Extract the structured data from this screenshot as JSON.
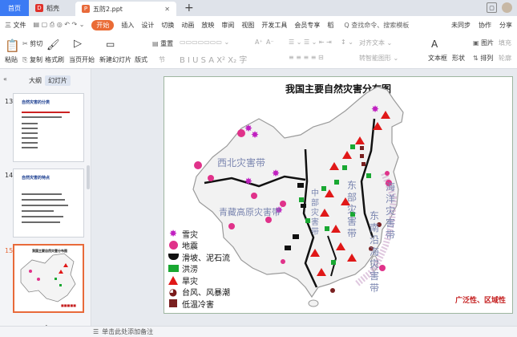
{
  "tabs": [
    {
      "label": "首页"
    },
    {
      "label": "稻壳"
    },
    {
      "label": "五防2.ppt"
    }
  ],
  "menu": {
    "file": "三 文件",
    "items": [
      "开始",
      "插入",
      "设计",
      "切换",
      "动画",
      "放映",
      "审阅",
      "视图",
      "开发工具",
      "会员专享",
      "稻"
    ],
    "search": "Q 查找命令、搜索模板",
    "right": [
      "未同步",
      "协作",
      "分享"
    ]
  },
  "toolbar": {
    "paste": "粘贴",
    "cut": "剪切",
    "copy": "复制",
    "format_painter": "格式刷",
    "from_current": "当页开始",
    "new_slide": "新建幻灯片",
    "layout": "版式",
    "section": "节",
    "reset": "重置",
    "font_size_up": "A⁺",
    "font_size_down": "A⁻",
    "align_text": "对齐文本",
    "convert_smartart": "转智能图形",
    "text_box": "文本框",
    "shape": "形状",
    "arrange": "排列",
    "picture": "图片",
    "fill": "填充",
    "outline": "轮廓"
  },
  "panel": {
    "collapse": "«",
    "tab_outline": "大纲",
    "tab_slides": "幻灯片",
    "slides": [
      {
        "num": "13",
        "title": "自然灾害的分类"
      },
      {
        "num": "14",
        "title": "自然灾害的特点"
      },
      {
        "num": "15",
        "title": "我国主要自然灾害分布图"
      }
    ],
    "add": "+"
  },
  "slide": {
    "title": "我国主要自然灾害分布图",
    "regions": {
      "northwest": "西北灾害带",
      "qingzang": "青藏高原灾害带",
      "central": [
        "中",
        "部",
        "灾",
        "害",
        "带"
      ],
      "east": [
        "东",
        "部",
        "灾",
        "害",
        "带"
      ],
      "coastal": [
        "东",
        "南",
        "沿",
        "海",
        "灾",
        "害",
        "带"
      ],
      "ocean": [
        "海",
        "洋",
        "灾",
        "害",
        "带"
      ]
    },
    "legend": [
      {
        "label": "雪灾",
        "icon": "star-icon",
        "color": "#c020c0"
      },
      {
        "label": "地震",
        "icon": "circle-icon",
        "color": "#e0328a"
      },
      {
        "label": "滑坡、泥石流",
        "icon": "landslide-icon",
        "color": "#111111"
      },
      {
        "label": "洪涝",
        "icon": "flood-icon",
        "color": "#19a832"
      },
      {
        "label": "旱灾",
        "icon": "triangle-icon",
        "color": "#e01818"
      },
      {
        "label": "台风、风暴潮",
        "icon": "typhoon-icon",
        "color": "#7a1a1a"
      },
      {
        "label": "低温冷害",
        "icon": "square-icon",
        "color": "#7a2020"
      }
    ],
    "footnote": "广泛性、区域性"
  },
  "status": {
    "notes": "单击此处添加备注"
  }
}
